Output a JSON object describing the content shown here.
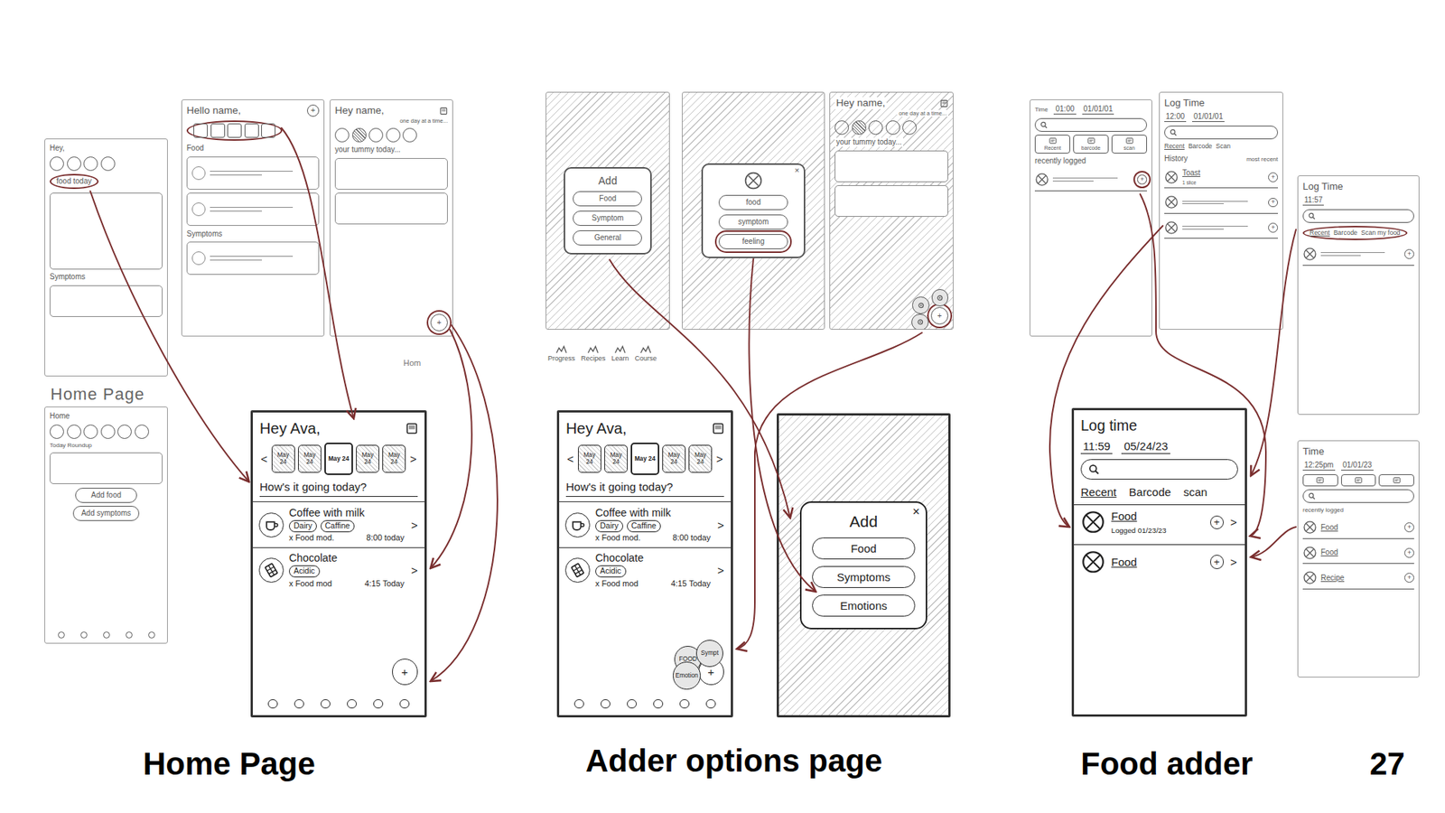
{
  "slide": {
    "page_number": "27"
  },
  "sections": [
    {
      "caption": "Home Page",
      "notes": [
        {
          "text": "Hom"
        }
      ],
      "toolbar": [],
      "sketches": [
        {
          "kind": "sketch",
          "overlay": false,
          "elements": [
            {
              "kind": "text",
              "text": "Hey,",
              "highlighted": false
            },
            {
              "kind": "circles",
              "highlighted": false,
              "items": [
                {
                  "filled": false
                },
                {
                  "filled": false
                },
                {
                  "filled": false
                },
                {
                  "filled": false
                }
              ]
            },
            {
              "kind": "text",
              "text": "food today",
              "highlighted": true
            },
            {
              "kind": "box-tall"
            },
            {
              "kind": "text",
              "text": "Symptoms",
              "highlighted": false
            },
            {
              "kind": "box"
            }
          ]
        },
        {
          "kind": "sketch",
          "overlay": false,
          "elements": [
            {
              "kind": "header",
              "text": "Hello name,",
              "action": "+"
            },
            {
              "kind": "squares",
              "highlighted": true,
              "items": [
                {
                  "filled": false
                },
                {
                  "filled": false
                },
                {
                  "filled": false
                },
                {
                  "filled": false
                },
                {
                  "filled": false
                }
              ]
            },
            {
              "kind": "text",
              "text": "Food",
              "highlighted": false
            },
            {
              "kind": "card"
            },
            {
              "kind": "card"
            },
            {
              "kind": "text",
              "text": "Symptoms",
              "highlighted": false
            },
            {
              "kind": "card"
            }
          ]
        },
        {
          "kind": "sketch",
          "overlay": false,
          "elements": [
            {
              "kind": "header",
              "text": "Hey name,",
              "subtitle": "one day at a time..."
            },
            {
              "kind": "circles",
              "highlighted": false,
              "items": [
                {
                  "filled": false
                },
                {
                  "filled": true
                },
                {
                  "filled": false
                },
                {
                  "filled": false
                },
                {
                  "filled": false
                }
              ]
            },
            {
              "kind": "text",
              "text": "your tummy today...",
              "highlighted": false
            },
            {
              "kind": "box"
            },
            {
              "kind": "box"
            },
            {
              "kind": "fab",
              "text": "+",
              "highlighted": true,
              "menu": []
            }
          ]
        },
        {
          "kind": "sketch",
          "title": "Home Page",
          "overlay": false,
          "elements": [
            {
              "kind": "text",
              "text": "Home",
              "highlighted": false
            },
            {
              "kind": "circles",
              "highlighted": false,
              "items": [
                {
                  "filled": false
                },
                {
                  "filled": false
                },
                {
                  "filled": false
                },
                {
                  "filled": false
                },
                {
                  "filled": false
                },
                {
                  "filled": false
                }
              ]
            },
            {
              "kind": "small",
              "text": "Today Roundup"
            },
            {
              "kind": "box"
            },
            {
              "kind": "pill",
              "text": "Add food",
              "highlighted": false
            },
            {
              "kind": "pill",
              "text": "Add symptoms",
              "highlighted": false
            },
            {
              "kind": "nav",
              "items": [
                {},
                {},
                {},
                {},
                {}
              ]
            }
          ]
        },
        {
          "kind": "final",
          "overlay": false,
          "elements": [
            {
              "kind": "header",
              "text": "Hey Ava,"
            },
            {
              "kind": "dates",
              "prev": "<",
              "next": ">",
              "items": [
                {
                  "label": "May 24",
                  "selected": false,
                  "crossed": true
                },
                {
                  "label": "May 24",
                  "selected": false,
                  "crossed": true
                },
                {
                  "label": "May 24",
                  "selected": true,
                  "crossed": false
                },
                {
                  "label": "May 24",
                  "selected": false,
                  "crossed": true
                },
                {
                  "label": "May 24",
                  "selected": false,
                  "crossed": true
                }
              ]
            },
            {
              "kind": "prompt",
              "text": "How's it going today?"
            },
            {
              "kind": "drink-row",
              "name": "Coffee with milk",
              "tags": [
                "Dairy",
                "Caffine"
              ],
              "mod": "x Food mod.",
              "time": "8:00 today",
              "chevron": ">"
            },
            {
              "kind": "snack-row",
              "name": "Chocolate",
              "tags": [
                "Acidic"
              ],
              "mod": "x Food mod",
              "time": "4:15 Today",
              "chevron": ">"
            },
            {
              "kind": "fab",
              "text": "+",
              "highlighted": false,
              "menu": []
            },
            {
              "kind": "nav",
              "items": [
                {},
                {},
                {},
                {},
                {},
                {}
              ]
            }
          ]
        }
      ]
    },
    {
      "caption": "Adder options page",
      "notes": [],
      "toolbar": [
        {
          "label": "Progress"
        },
        {
          "label": "Recipes"
        },
        {
          "label": "Learn"
        },
        {
          "label": "Course"
        }
      ],
      "sketches": [
        {
          "kind": "sketch",
          "overlay": true,
          "elements": [
            {
              "kind": "dialog",
              "title": "Add",
              "items": [
                {
                  "text": "Food",
                  "highlighted": false
                },
                {
                  "text": "Symptom",
                  "highlighted": false
                },
                {
                  "text": "General",
                  "highlighted": false
                }
              ]
            }
          ]
        },
        {
          "kind": "sketch",
          "overlay": true,
          "elements": [
            {
              "kind": "icon-dialog",
              "close": "×",
              "items": [
                {
                  "text": "food",
                  "highlighted": false
                },
                {
                  "text": "symptom",
                  "highlighted": false
                },
                {
                  "text": "feeling",
                  "highlighted": true
                }
              ]
            }
          ]
        },
        {
          "kind": "sketch",
          "overlay": true,
          "elements": [
            {
              "kind": "header",
              "text": "Hey name,",
              "subtitle": "one day at a time..."
            },
            {
              "kind": "circles",
              "highlighted": false,
              "items": [
                {
                  "filled": false
                },
                {
                  "filled": true
                },
                {
                  "filled": false
                },
                {
                  "filled": false
                },
                {
                  "filled": false
                }
              ]
            },
            {
              "kind": "text",
              "text": "your tummy today...",
              "highlighted": false
            },
            {
              "kind": "box"
            },
            {
              "kind": "box"
            },
            {
              "kind": "fab",
              "text": "+",
              "highlighted": true,
              "menu": [
                {},
                {},
                {}
              ]
            }
          ]
        },
        {
          "kind": "final",
          "overlay": false,
          "elements": [
            {
              "kind": "header",
              "text": "Hey Ava,"
            },
            {
              "kind": "dates",
              "prev": "<",
              "next": ">",
              "items": [
                {
                  "label": "May 24",
                  "selected": false,
                  "crossed": true
                },
                {
                  "label": "May 24",
                  "selected": false,
                  "crossed": true
                },
                {
                  "label": "May 24",
                  "selected": true,
                  "crossed": false
                },
                {
                  "label": "May 24",
                  "selected": false,
                  "crossed": true
                },
                {
                  "label": "May 24",
                  "selected": false,
                  "crossed": true
                }
              ]
            },
            {
              "kind": "prompt",
              "text": "How's it going today?"
            },
            {
              "kind": "drink-row",
              "name": "Coffee with milk",
              "tags": [
                "Dairy",
                "Caffine"
              ],
              "mod": "x Food mod.",
              "time": "8:00 today",
              "chevron": ">"
            },
            {
              "kind": "snack-row",
              "name": "Chocolate",
              "tags": [
                "Acidic"
              ],
              "mod": "x Food mod",
              "time": "4:15 Today",
              "chevron": ">"
            },
            {
              "kind": "fab",
              "text": "+",
              "highlighted": false,
              "menu": [
                {
                  "label": "FOOD"
                },
                {
                  "label": "Sympt"
                },
                {
                  "label": "Emotion"
                }
              ]
            },
            {
              "kind": "nav",
              "items": [
                {},
                {},
                {},
                {},
                {},
                {}
              ]
            }
          ]
        },
        {
          "kind": "final",
          "overlay": true,
          "elements": [
            {
              "kind": "dialog",
              "title": "Add",
              "close": "×",
              "items": [
                {
                  "text": "Food",
                  "highlighted": false
                },
                {
                  "text": "Symptoms",
                  "highlighted": false
                },
                {
                  "text": "Emotions",
                  "highlighted": false
                }
              ]
            }
          ]
        }
      ]
    },
    {
      "caption": "Food adder",
      "notes": [],
      "toolbar": [],
      "sketches": [
        {
          "kind": "sketch",
          "overlay": false,
          "elements": [
            {
              "kind": "datetime",
              "label": "Time",
              "time": "01:00",
              "date": "01/01/01"
            },
            {
              "kind": "search"
            },
            {
              "kind": "icon-tabs",
              "highlighted": false,
              "items": [
                {
                  "label": "Recent",
                  "selected": false
                },
                {
                  "label": "barcode",
                  "selected": false
                },
                {
                  "label": "scan",
                  "selected": false
                }
              ]
            },
            {
              "kind": "text",
              "text": "recently logged",
              "highlighted": false
            },
            {
              "kind": "log-row",
              "action": "+",
              "highlighted": true
            }
          ]
        },
        {
          "kind": "sketch",
          "overlay": false,
          "elements": [
            {
              "kind": "title",
              "text": "Log Time"
            },
            {
              "kind": "datetime",
              "time": "12:00",
              "date": "01/01/01"
            },
            {
              "kind": "search"
            },
            {
              "kind": "tabs",
              "highlighted": false,
              "items": [
                {
                  "label": "Recent",
                  "selected": true
                },
                {
                  "label": "Barcode",
                  "selected": false
                },
                {
                  "label": "Scan",
                  "selected": false
                }
              ]
            },
            {
              "kind": "split",
              "left": "History",
              "right": "most recent"
            },
            {
              "kind": "log-row",
              "name": "Toast",
              "sub": "1 slice",
              "action": "+",
              "highlighted": false
            },
            {
              "kind": "log-row",
              "action": "+",
              "highlighted": false
            },
            {
              "kind": "log-row",
              "action": "+",
              "highlighted": false
            }
          ]
        },
        {
          "kind": "sketch",
          "overlay": false,
          "elements": [
            {
              "kind": "title",
              "text": "Log Time"
            },
            {
              "kind": "datetime",
              "time": "11:57"
            },
            {
              "kind": "search"
            },
            {
              "kind": "tabs",
              "highlighted": true,
              "items": [
                {
                  "label": "Recent",
                  "selected": true
                },
                {
                  "label": "Barcode",
                  "selected": false
                },
                {
                  "label": "Scan my food",
                  "selected": false
                }
              ]
            },
            {
              "kind": "log-row",
              "action": "+",
              "highlighted": false
            }
          ]
        },
        {
          "kind": "sketch",
          "overlay": false,
          "elements": [
            {
              "kind": "title",
              "text": "Time"
            },
            {
              "kind": "datetime",
              "time": "12:25pm",
              "date": "01/01/23"
            },
            {
              "kind": "icon-tabs",
              "highlighted": false,
              "items": [
                {
                  "selected": false
                },
                {
                  "selected": false
                },
                {
                  "selected": false
                }
              ]
            },
            {
              "kind": "search"
            },
            {
              "kind": "small",
              "text": "recently logged"
            },
            {
              "kind": "log-row",
              "name": "Food",
              "action": "+",
              "highlighted": false
            },
            {
              "kind": "log-row",
              "name": "Food",
              "action": "+",
              "highlighted": false
            },
            {
              "kind": "log-row",
              "name": "Recipe",
              "action": "+",
              "highlighted": false
            }
          ]
        },
        {
          "kind": "final",
          "overlay": false,
          "elements": [
            {
              "kind": "title",
              "text": "Log time"
            },
            {
              "kind": "datetime",
              "time": "11:59",
              "date": "05/24/23"
            },
            {
              "kind": "search"
            },
            {
              "kind": "tabs",
              "highlighted": false,
              "items": [
                {
                  "label": "Recent",
                  "selected": true
                },
                {
                  "label": "Barcode",
                  "selected": false
                },
                {
                  "label": "scan",
                  "selected": false
                }
              ]
            },
            {
              "kind": "log-row",
              "name": "Food",
              "sub": "Logged 01/23/23",
              "action": "+",
              "chevron": ">",
              "highlighted": false
            },
            {
              "kind": "log-row",
              "name": "Food",
              "action": "+",
              "chevron": ">",
              "highlighted": false
            }
          ]
        }
      ]
    }
  ]
}
